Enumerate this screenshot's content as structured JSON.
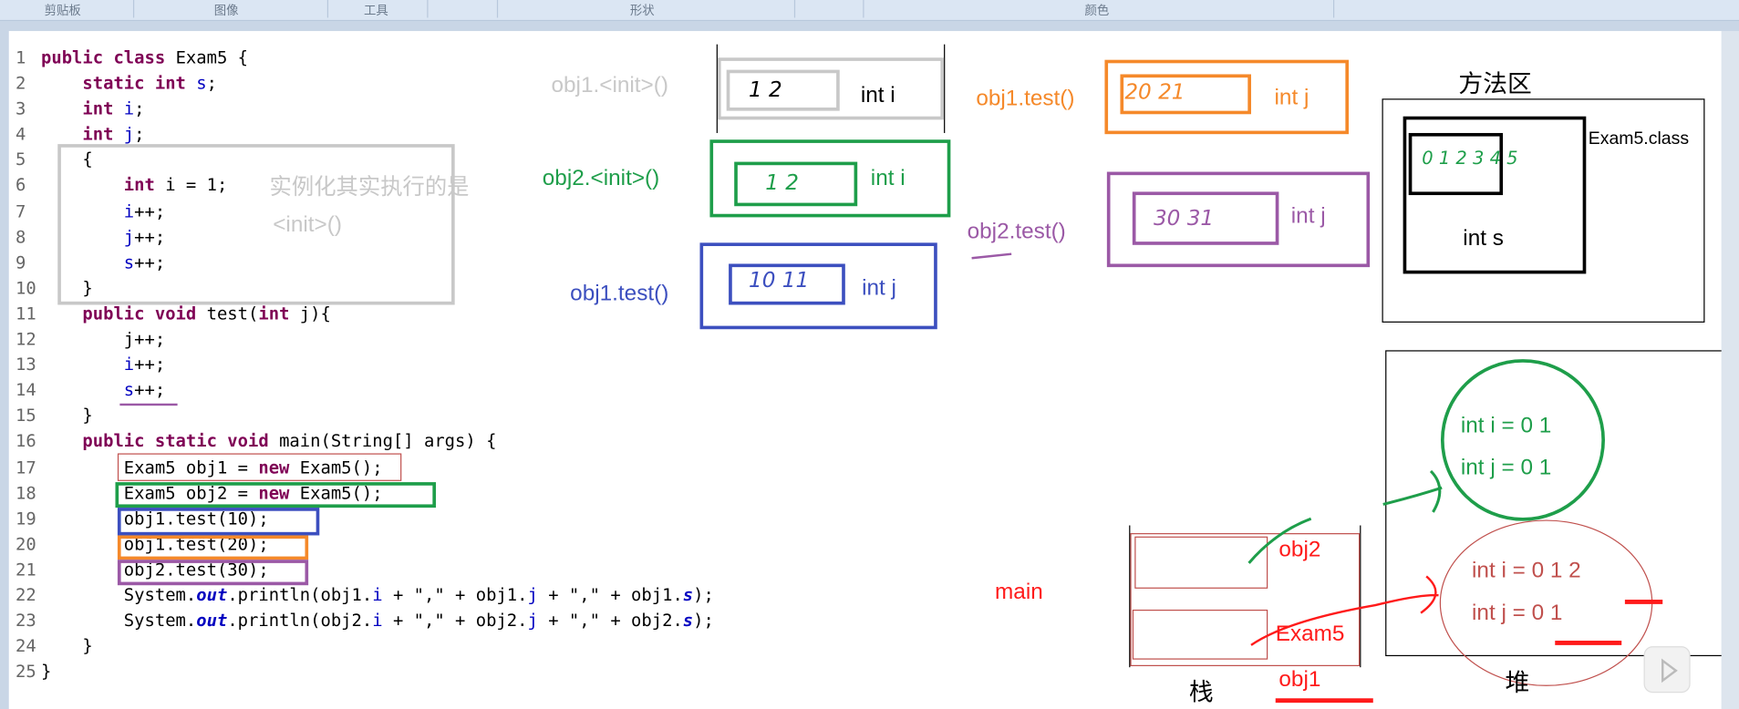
{
  "toolbar": {
    "groups": [
      "剪贴板",
      "图像",
      "工具",
      "形状",
      "颜色"
    ]
  },
  "colors": {
    "gray": "#c8c8c8",
    "green": "#1e9e4a",
    "blue": "#3c4fbf",
    "orange": "#f5892a",
    "purple": "#9b59a6",
    "red": "#c0504d",
    "bright_red": "#ff1a1a"
  },
  "code": {
    "lines": [
      [
        [
          "kw",
          "public class "
        ],
        [
          "",
          "Exam5 {"
        ]
      ],
      [
        [
          "",
          "    "
        ],
        [
          "kw",
          "static int "
        ],
        [
          "fd",
          "s"
        ],
        [
          "",
          ";"
        ]
      ],
      [
        [
          "",
          "    "
        ],
        [
          "kw",
          "int "
        ],
        [
          "fd",
          "i"
        ],
        [
          "",
          ";"
        ]
      ],
      [
        [
          "",
          "    "
        ],
        [
          "kw",
          "int "
        ],
        [
          "fd",
          "j"
        ],
        [
          "",
          ";"
        ]
      ],
      [
        [
          "",
          "    {"
        ]
      ],
      [
        [
          "",
          "        "
        ],
        [
          "kw",
          "int "
        ],
        [
          "",
          "i = 1;"
        ]
      ],
      [
        [
          "",
          "        "
        ],
        [
          "fd",
          "i"
        ],
        [
          "",
          "++;"
        ]
      ],
      [
        [
          "",
          "        "
        ],
        [
          "fd",
          "j"
        ],
        [
          "",
          "++;"
        ]
      ],
      [
        [
          "",
          "        "
        ],
        [
          "fd",
          "s"
        ],
        [
          "",
          "++;"
        ]
      ],
      [
        [
          "",
          "    }"
        ]
      ],
      [
        [
          "",
          "    "
        ],
        [
          "kw",
          "public void "
        ],
        [
          "",
          "test("
        ],
        [
          "kw",
          "int "
        ],
        [
          "",
          "j){"
        ]
      ],
      [
        [
          "",
          "        j++;"
        ]
      ],
      [
        [
          "",
          "        "
        ],
        [
          "fd",
          "i"
        ],
        [
          "",
          "++;"
        ]
      ],
      [
        [
          "",
          "        "
        ],
        [
          "fd",
          "s"
        ],
        [
          "",
          "++;"
        ]
      ],
      [
        [
          "",
          "    }"
        ]
      ],
      [
        [
          "",
          "    "
        ],
        [
          "kw",
          "public static void "
        ],
        [
          "",
          "main(String[] args) {"
        ]
      ],
      [
        [
          "",
          "        Exam5 obj1 = "
        ],
        [
          "kw",
          "new "
        ],
        [
          "",
          "Exam5();"
        ]
      ],
      [
        [
          "",
          "        Exam5 obj2 = "
        ],
        [
          "kw",
          "new "
        ],
        [
          "",
          "Exam5();"
        ]
      ],
      [
        [
          "",
          "        obj1.test(10);"
        ]
      ],
      [
        [
          "",
          "        obj1.test(20);"
        ]
      ],
      [
        [
          "",
          "        obj2.test(30);"
        ]
      ],
      [
        [
          "",
          "        System."
        ],
        [
          "st",
          "out"
        ],
        [
          "",
          ".println(obj1."
        ],
        [
          "fd",
          "i"
        ],
        [
          "",
          " + \",\" + obj1."
        ],
        [
          "fd",
          "j"
        ],
        [
          "",
          " + \",\" + obj1."
        ],
        [
          "st",
          "s"
        ],
        [
          "",
          ");"
        ]
      ],
      [
        [
          "",
          "        System."
        ],
        [
          "st",
          "out"
        ],
        [
          "",
          ".println(obj2."
        ],
        [
          "fd",
          "i"
        ],
        [
          "",
          " + \",\" + obj2."
        ],
        [
          "fd",
          "j"
        ],
        [
          "",
          " + \",\" + obj2."
        ],
        [
          "st",
          "s"
        ],
        [
          "",
          ");"
        ]
      ],
      [
        [
          "",
          "    }"
        ]
      ],
      [
        [
          "",
          "}"
        ]
      ]
    ]
  },
  "note": {
    "line1": "实例化其实执行的是",
    "line2": "<init>()"
  },
  "frames": {
    "obj1_init": {
      "label": "obj1.<init>()",
      "var": "int i",
      "hand": "1 2"
    },
    "obj2_init": {
      "label": "obj2.<init>()",
      "var": "int i",
      "hand": "1 2"
    },
    "obj1_test10": {
      "label": "obj1.test()",
      "var": "int j",
      "hand": "10 11"
    },
    "obj1_test20": {
      "label": "obj1.test()",
      "var": "int j",
      "hand": "20 21"
    },
    "obj2_test30": {
      "label": "obj2.test()",
      "var": "int j",
      "hand": "30 31"
    }
  },
  "method_area": {
    "title": "方法区",
    "class_label": "Exam5.class",
    "field": "int s",
    "hand": "0 1 2 3 4 5"
  },
  "heap": {
    "title": "堆",
    "obj2": {
      "i": "int i = 0 1",
      "j": "int j = 0 1"
    },
    "obj1": {
      "i": "int i = 0 1 2",
      "j": "int j = 0 1"
    }
  },
  "stack": {
    "title": "栈",
    "frame": "main",
    "obj2": "obj2",
    "exam5": "Exam5",
    "obj1": "obj1"
  }
}
